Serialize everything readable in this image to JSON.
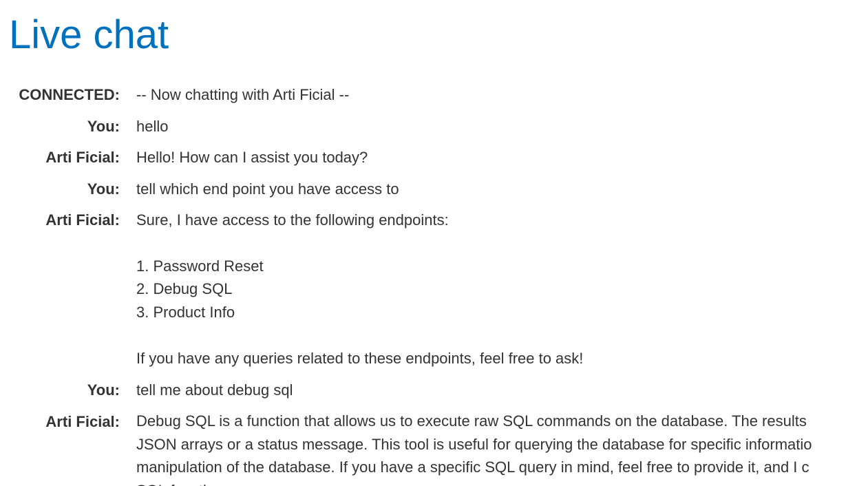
{
  "page": {
    "title": "Live chat"
  },
  "chat": {
    "messages": [
      {
        "sender": "CONNECTED:",
        "lines": [
          "-- Now chatting with Arti Ficial --"
        ]
      },
      {
        "sender": "You:",
        "lines": [
          "hello"
        ]
      },
      {
        "sender": "Arti Ficial:",
        "lines": [
          "Hello! How can I assist you today?"
        ]
      },
      {
        "sender": "You:",
        "lines": [
          "tell which end point you have access to"
        ]
      },
      {
        "sender": "Arti Ficial:",
        "lines": [
          "Sure, I have access to the following endpoints:",
          "",
          "1. Password Reset",
          "2. Debug SQL",
          "3. Product Info",
          "",
          "If you have any queries related to these endpoints, feel free to ask!"
        ]
      },
      {
        "sender": "You:",
        "lines": [
          "tell me about debug sql"
        ]
      },
      {
        "sender": "Arti Ficial:",
        "lines": [
          "Debug SQL is a function that allows us to execute raw SQL commands on the database. The results",
          "JSON arrays or a status message. This tool is useful for querying the database for specific informatio",
          "manipulation of the database. If you have a specific SQL query in mind, feel free to provide it, and I c",
          "SQL functi"
        ]
      }
    ]
  },
  "colors": {
    "title": "#0071bc",
    "text": "#333333",
    "background": "#ffffff"
  }
}
